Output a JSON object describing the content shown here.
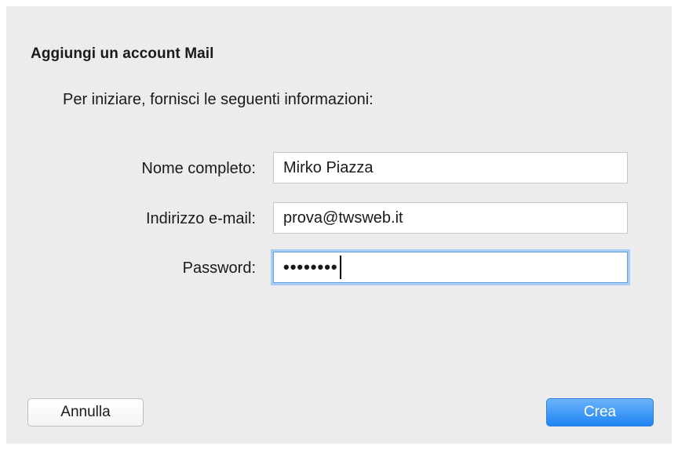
{
  "dialog": {
    "title": "Aggiungi un account Mail",
    "intro": "Per iniziare, fornisci le seguenti informazioni:"
  },
  "form": {
    "name_label": "Nome completo:",
    "name_value": "Mirko Piazza",
    "email_label": "Indirizzo e-mail:",
    "email_value": "prova@twsweb.it",
    "password_label": "Password:",
    "password_masked": "••••••••"
  },
  "buttons": {
    "cancel_label": "Annulla",
    "create_label": "Crea"
  },
  "colors": {
    "accent": "#1f84f3",
    "focus_ring": "#a9ccf2",
    "background": "#ececec"
  }
}
